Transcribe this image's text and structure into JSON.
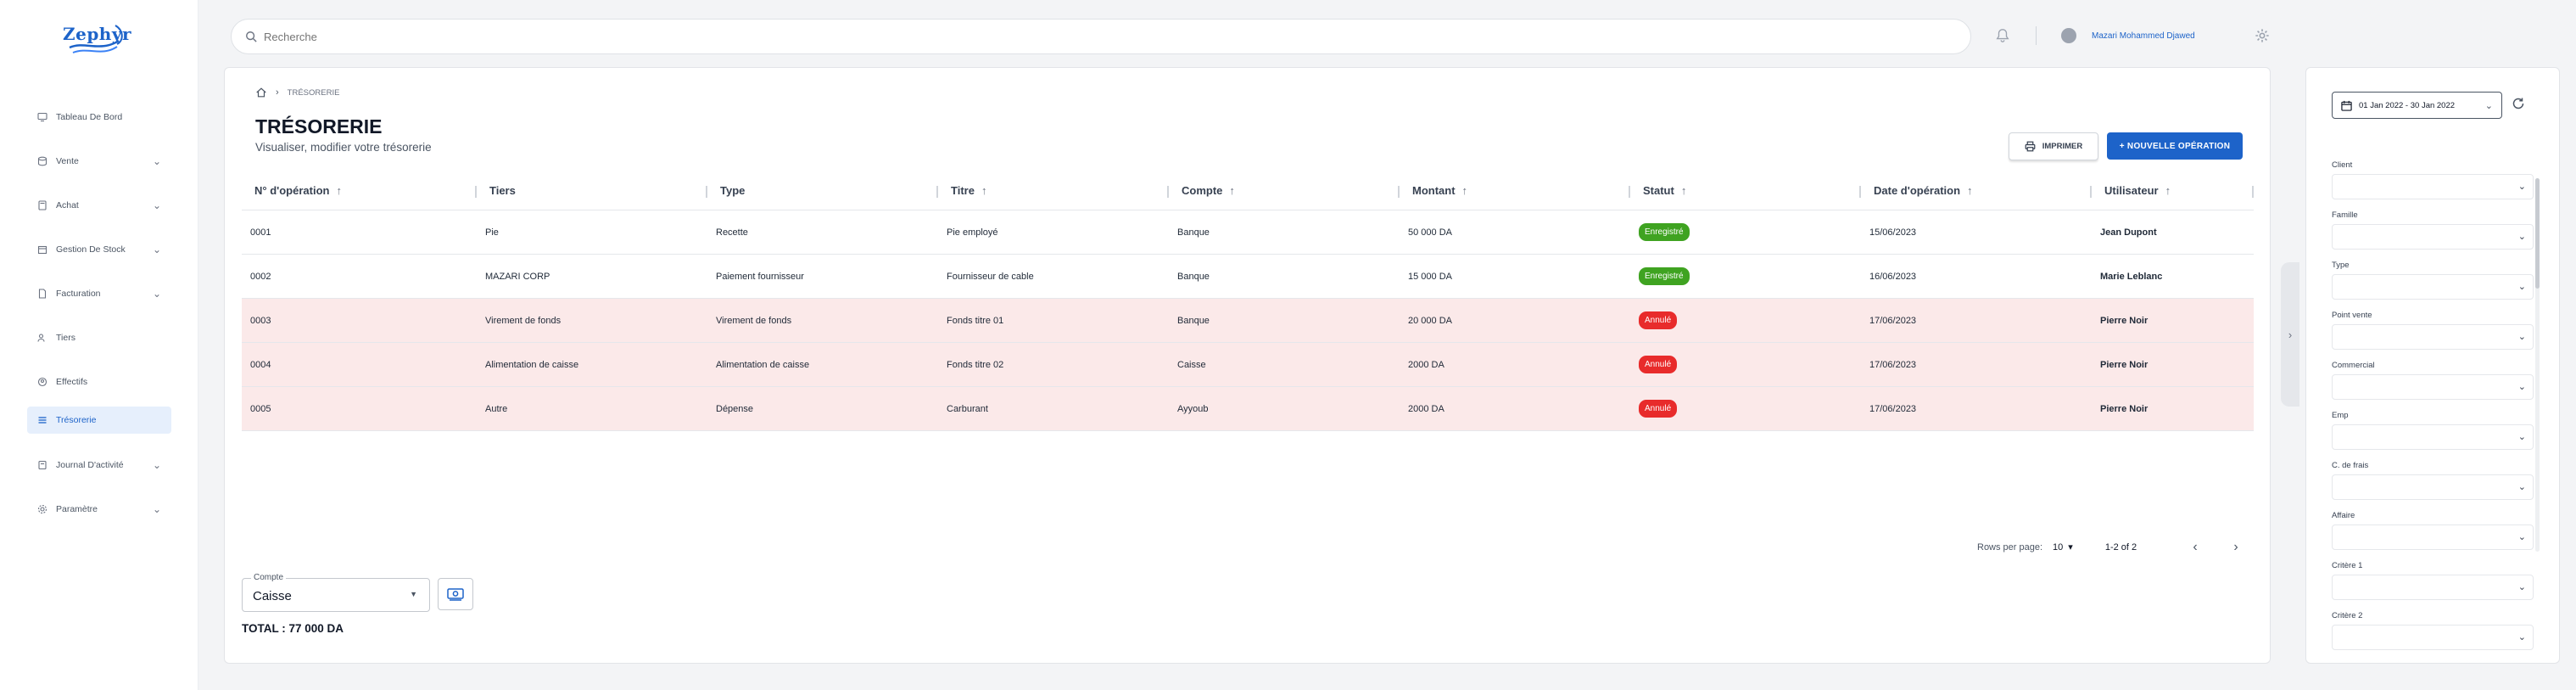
{
  "app": {
    "logo_text": "Zephyr"
  },
  "sidebar": {
    "items": [
      {
        "label": "Tableau De Bord",
        "icon": "monitor-icon",
        "chevron": ""
      },
      {
        "label": "Vente",
        "icon": "database-icon",
        "chevron": "⌄"
      },
      {
        "label": "Achat",
        "icon": "calculator-icon",
        "chevron": "⌄"
      },
      {
        "label": "Gestion De Stock",
        "icon": "box-icon",
        "chevron": "⌄"
      },
      {
        "label": "Facturation",
        "icon": "document-icon",
        "chevron": "⌄"
      },
      {
        "label": "Tiers",
        "icon": "users-icon",
        "chevron": ""
      },
      {
        "label": "Effectifs",
        "icon": "briefcase-icon",
        "chevron": ""
      },
      {
        "label": "Trésorerie",
        "icon": "list-icon",
        "chevron": ""
      },
      {
        "label": "Journal D'activité",
        "icon": "journal-icon",
        "chevron": "⌄"
      },
      {
        "label": "Paramètre",
        "icon": "settings-icon",
        "chevron": "⌄"
      }
    ],
    "active_index": 7
  },
  "topbar": {
    "search_placeholder": "Recherche",
    "user_name": "Mazari Mohammed Djawed"
  },
  "page": {
    "breadcrumb": "TRÉSORERIE",
    "title": "TRÉSORERIE",
    "subtitle": "Visualiser, modifier votre trésorerie",
    "print_label": "IMPRIMER",
    "new_label": "+ NOUVELLE OPÉRATION"
  },
  "table": {
    "columns": [
      {
        "label": "N° d'opération",
        "sortable": true
      },
      {
        "label": "Tiers",
        "sortable": false
      },
      {
        "label": "Type",
        "sortable": false
      },
      {
        "label": "Titre",
        "sortable": true
      },
      {
        "label": "Compte",
        "sortable": true
      },
      {
        "label": "Montant",
        "sortable": true
      },
      {
        "label": "Statut",
        "sortable": true
      },
      {
        "label": "Date d'opération",
        "sortable": true
      },
      {
        "label": "Utilisateur",
        "sortable": true
      }
    ],
    "rows": [
      {
        "num": "0001",
        "tiers": "Pie",
        "type": "Recette",
        "titre": "Pie employé",
        "compte": "Banque",
        "montant": "50 000 DA",
        "statut": "Enregistré",
        "status_color": "#3fa321",
        "date": "15/06/2023",
        "user": "Jean Dupont",
        "cancelled": false
      },
      {
        "num": "0002",
        "tiers": "MAZARI CORP",
        "type": "Paiement fournisseur",
        "titre": "Fournisseur de cable",
        "compte": "Banque",
        "montant": "15 000 DA",
        "statut": "Enregistré",
        "status_color": "#3fa321",
        "date": "16/06/2023",
        "user": "Marie Leblanc",
        "cancelled": false
      },
      {
        "num": "0003",
        "tiers": "Virement de fonds",
        "type": "Virement de fonds",
        "titre": "Fonds titre 01",
        "compte": "Banque",
        "montant": "20 000 DA",
        "statut": "Annulé",
        "status_color": "#e82b2b",
        "date": "17/06/2023",
        "user": "Pierre Noir",
        "cancelled": true
      },
      {
        "num": "0004",
        "tiers": "Alimentation de caisse",
        "type": "Alimentation de caisse",
        "titre": "Fonds titre 02",
        "compte": "Caisse",
        "montant": "2000 DA",
        "statut": "Annulé",
        "status_color": "#e82b2b",
        "date": "17/06/2023",
        "user": "Pierre Noir",
        "cancelled": true
      },
      {
        "num": "0005",
        "tiers": "Autre",
        "type": "Dépense",
        "titre": "Carburant",
        "compte": "Ayyoub",
        "montant": "2000 DA",
        "statut": "Annulé",
        "status_color": "#e82b2b",
        "date": "17/06/2023",
        "user": "Pierre Noir",
        "cancelled": true
      }
    ]
  },
  "pagination": {
    "rows_per_page_label": "Rows per page:",
    "rows_per_page": "10",
    "range": "1-2 of 2"
  },
  "footer": {
    "compte_label": "Compte",
    "compte_value": "Caisse",
    "total": "TOTAL : 77 000 DA"
  },
  "filters": {
    "date_range": "01 Jan 2022 - 30 Jan 2022",
    "fields": [
      {
        "label": "Client",
        "placeholder": ""
      },
      {
        "label": "Famille",
        "placeholder": ""
      },
      {
        "label": "Type",
        "placeholder": ""
      },
      {
        "label": "Point vente",
        "placeholder": ""
      },
      {
        "label": "Commercial",
        "placeholder": ""
      },
      {
        "label": "Emp",
        "placeholder": ""
      },
      {
        "label": "C. de frais",
        "placeholder": ""
      },
      {
        "label": "Affaire",
        "placeholder": ""
      },
      {
        "label": "Critère 1",
        "placeholder": ""
      },
      {
        "label": "Critère 2",
        "placeholder": ""
      }
    ]
  },
  "colors": {
    "accent": "#1d63c9",
    "success": "#3fa321",
    "danger": "#e82b2b",
    "cancelled_row": "#fbe9e9"
  }
}
